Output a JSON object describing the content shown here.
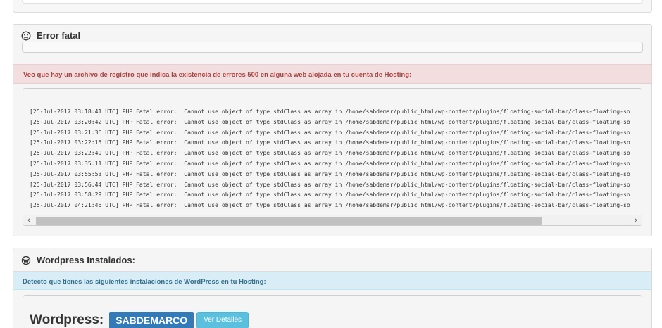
{
  "error_panel": {
    "title": "Error fatal",
    "alert": "Veo que hay un archivo de registro que indica la existencia de errores 500 en alguna web alojada en tu cuenta de Hosting:",
    "log_lines": [
      "[25-Jul-2017 03:18:41 UTC] PHP Fatal error:  Cannot use object of type stdClass as array in /home/sabdemar/public_html/wp-content/plugins/floating-social-bar/class-floating-so",
      "[25-Jul-2017 03:20:42 UTC] PHP Fatal error:  Cannot use object of type stdClass as array in /home/sabdemar/public_html/wp-content/plugins/floating-social-bar/class-floating-so",
      "[25-Jul-2017 03:21:36 UTC] PHP Fatal error:  Cannot use object of type stdClass as array in /home/sabdemar/public_html/wp-content/plugins/floating-social-bar/class-floating-so",
      "[25-Jul-2017 03:22:15 UTC] PHP Fatal error:  Cannot use object of type stdClass as array in /home/sabdemar/public_html/wp-content/plugins/floating-social-bar/class-floating-so",
      "[25-Jul-2017 03:22:49 UTC] PHP Fatal error:  Cannot use object of type stdClass as array in /home/sabdemar/public_html/wp-content/plugins/floating-social-bar/class-floating-so",
      "[25-Jul-2017 03:35:11 UTC] PHP Fatal error:  Cannot use object of type stdClass as array in /home/sabdemar/public_html/wp-content/plugins/floating-social-bar/class-floating-so",
      "[25-Jul-2017 03:55:53 UTC] PHP Fatal error:  Cannot use object of type stdClass as array in /home/sabdemar/public_html/wp-content/plugins/floating-social-bar/class-floating-so",
      "[25-Jul-2017 03:56:44 UTC] PHP Fatal error:  Cannot use object of type stdClass as array in /home/sabdemar/public_html/wp-content/plugins/floating-social-bar/class-floating-so",
      "[25-Jul-2017 03:58:29 UTC] PHP Fatal error:  Cannot use object of type stdClass as array in /home/sabdemar/public_html/wp-content/plugins/floating-social-bar/class-floating-so",
      "[25-Jul-2017 04:21:46 UTC] PHP Fatal error:  Cannot use object of type stdClass as array in /home/sabdemar/public_html/wp-content/plugins/floating-social-bar/class-floating-so"
    ],
    "scroll_left": "‹",
    "scroll_right": "›",
    "icon": "sad-face-icon"
  },
  "wordpress_panel": {
    "title": "Wordpress Instalados:",
    "alert": "Detecto que tienes las siguientes instalaciones de WordPress en tu Hosting:",
    "install_label": "Wordpress:",
    "install_name": "SABDEMARCO",
    "details_button": "Ver Detalles",
    "icon": "wordpress-icon"
  },
  "colors": {
    "danger_bg": "#f2dede",
    "danger_text": "#a94442",
    "info_bg": "#d9edf7",
    "info_text": "#31708f",
    "primary": "#337ab7",
    "info_button": "#5bc0de"
  }
}
